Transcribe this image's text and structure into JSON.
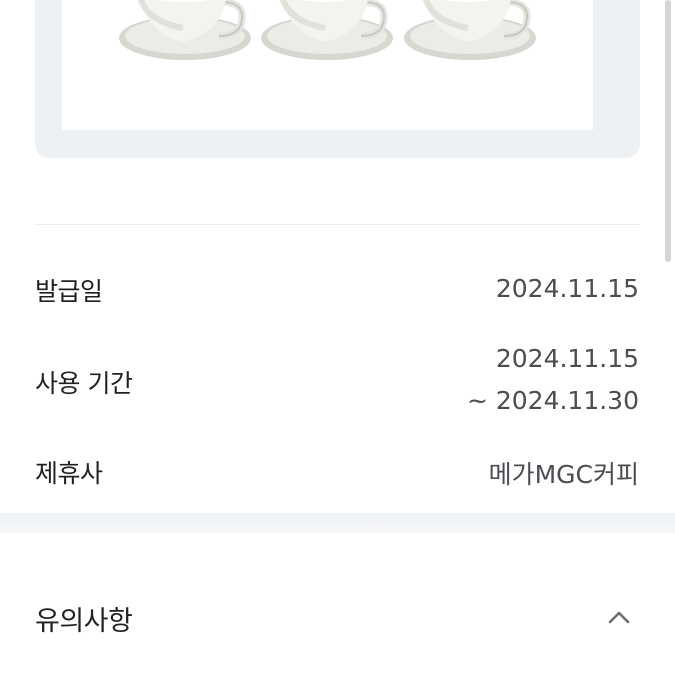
{
  "product_image": {
    "icon": "coffee-cup-icon",
    "cup_count": 3
  },
  "details": {
    "issue_date": {
      "label": "발급일",
      "value": "2024.11.15"
    },
    "usage_period": {
      "label": "사용 기간",
      "start": "2024.11.15",
      "end": "~ 2024.11.30"
    },
    "partner": {
      "label": "제휴사",
      "value": "메가MGC커피"
    }
  },
  "notice": {
    "title": "유의사항",
    "toggle_icon": "chevron-up-icon",
    "expanded": true
  },
  "colors": {
    "background": "#ffffff",
    "card": "#eef1f4",
    "text_primary": "#1f2124",
    "text_secondary": "#4a4d52"
  }
}
